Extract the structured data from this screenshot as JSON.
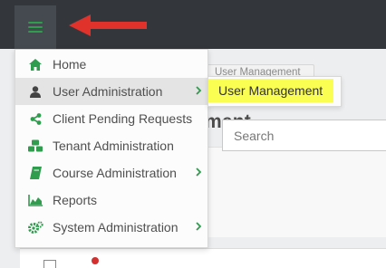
{
  "breadcrumb": {
    "current": "User Management"
  },
  "page": {
    "title_fragment": "ment"
  },
  "search": {
    "placeholder": "Search"
  },
  "menu": {
    "items": [
      {
        "label": "Home",
        "icon": "home-icon",
        "has_submenu": false
      },
      {
        "label": "User Administration",
        "icon": "user-icon",
        "has_submenu": true,
        "active": true
      },
      {
        "label": "Client Pending Requests",
        "icon": "share-icon",
        "has_submenu": false
      },
      {
        "label": "Tenant Administration",
        "icon": "tenant-icon",
        "has_submenu": false
      },
      {
        "label": "Course Administration",
        "icon": "book-icon",
        "has_submenu": true
      },
      {
        "label": "Reports",
        "icon": "chart-area-icon",
        "has_submenu": false
      },
      {
        "label": "System Administration",
        "icon": "cogs-icon",
        "has_submenu": true
      }
    ]
  },
  "submenu": {
    "label": "User Management"
  },
  "colors": {
    "topbar": "#33373c",
    "accent_green": "#2f9c4e",
    "arrow_red": "#e0312b",
    "highlight_yellow": "#fafd52"
  }
}
